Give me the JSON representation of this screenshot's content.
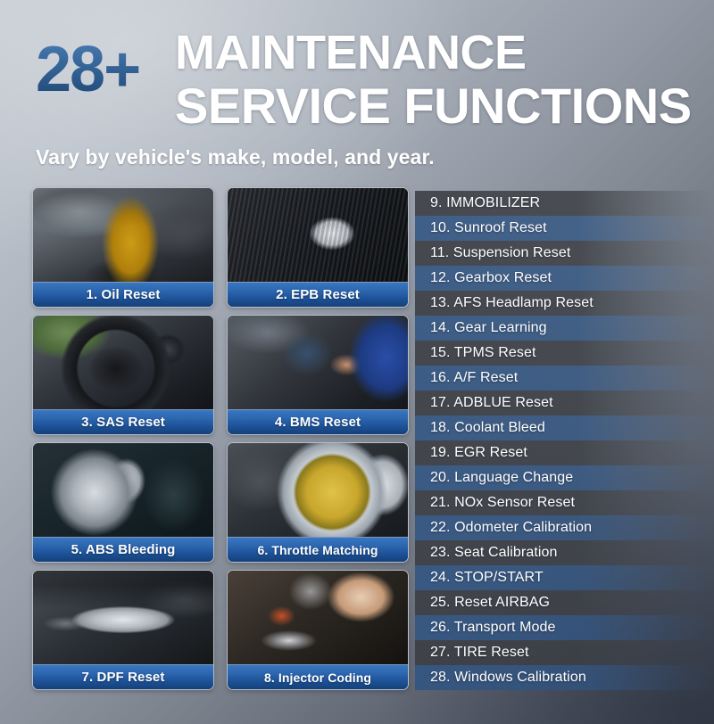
{
  "header": {
    "count": "28+",
    "title_line1": "MAINTENANCE",
    "title_line2": "SERVICE FUNCTIONS",
    "subtitle": "Vary by vehicle's make, model, and year."
  },
  "colors": {
    "accent_blue": "#2a64ad",
    "count_blue_light": "#4a7cb5",
    "count_blue_dark": "#1d4775",
    "row_odd": "#3a3d42",
    "row_even": "#2f5483",
    "text_white": "#ffffff",
    "bg_light": "#c2c8d0",
    "bg_dark": "#3e4553"
  },
  "cards": [
    {
      "label": "1. Oil Reset",
      "photo": "oil-pouring-into-engine-photo",
      "photo_class": "ph-oil"
    },
    {
      "label": "2. EPB Reset",
      "photo": "electronic-parking-brake-switch-photo",
      "photo_class": "ph-epb"
    },
    {
      "label": "3. SAS Reset",
      "photo": "car-steering-wheel-dashboard-photo",
      "photo_class": "ph-sas"
    },
    {
      "label": "4. BMS Reset",
      "photo": "technician-replacing-car-battery-photo",
      "photo_class": "ph-bms"
    },
    {
      "label": "5. ABS Bleeding",
      "photo": "brake-disc-caliper-assembly-photo",
      "photo_class": "ph-abs"
    },
    {
      "label": "6. Throttle Matching",
      "photo": "throttle-body-valve-photo",
      "photo_class": "ph-thr"
    },
    {
      "label": "7. DPF Reset",
      "photo": "exhaust-muffler-under-vehicle-photo",
      "photo_class": "ph-dpf"
    },
    {
      "label": "8. Injector Coding",
      "photo": "hands-cleaning-fuel-injectors-photo",
      "photo_class": "ph-inj"
    }
  ],
  "function_list": [
    "9. IMMOBILIZER",
    "10. Sunroof Reset",
    "11. Suspension Reset",
    "12. Gearbox Reset",
    "13. AFS Headlamp Reset",
    "14. Gear Learning",
    "15. TPMS Reset",
    "16. A/F Reset",
    "17. ADBLUE Reset",
    "18. Coolant Bleed",
    "19. EGR Reset",
    "20. Language Change",
    "21. NOx Sensor Reset",
    "22. Odometer Calibration",
    "23. Seat Calibration",
    "24. STOP/START",
    "25. Reset AIRBAG",
    "26. Transport Mode",
    "27. TIRE Reset",
    "28. Windows Calibration"
  ]
}
